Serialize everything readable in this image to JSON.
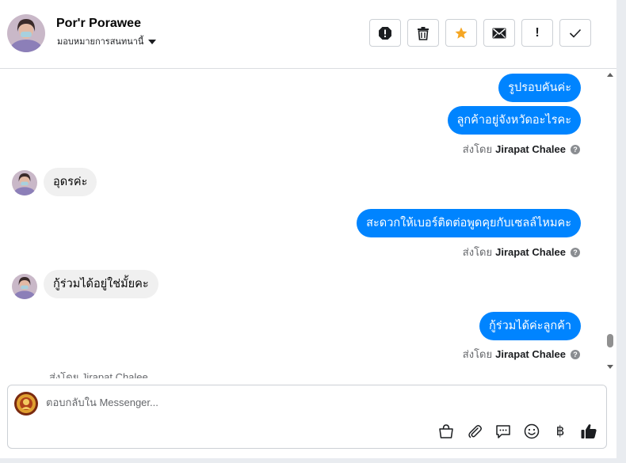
{
  "header": {
    "name": "Por'r Porawee",
    "assign_label": "มอบหมายการสนทนานี้"
  },
  "actions": [
    {
      "icon": "spam-icon"
    },
    {
      "icon": "trash-icon"
    },
    {
      "icon": "star-icon",
      "color": "#f5a623"
    },
    {
      "icon": "envelope-icon"
    },
    {
      "icon": "exclamation-icon",
      "label": "!"
    },
    {
      "icon": "check-icon"
    }
  ],
  "messages": {
    "out1": "รูปรอบคันค่ะ",
    "out2": "ลูกค้าอยู่จังหวัดอะไรคะ",
    "sent_by_label": "ส่งโดย",
    "sender_name": "Jirapat Chalee",
    "in1": "อุดรค่ะ",
    "out3": "สะดวกให้เบอร์ติดต่อพูดคุยกับเซลล์ไหมคะ",
    "in2": "กู้ร่วมได้อยู่ใช่มั้ยคะ",
    "out4": "กู้ร่วมได้ค่ะลูกค้า",
    "partial": "ส่งโดย Jirapat Chalee"
  },
  "composer": {
    "placeholder": "ตอบกลับใน Messenger..."
  },
  "tools": [
    {
      "icon": "basket-icon"
    },
    {
      "icon": "paperclip-icon"
    },
    {
      "icon": "saved-reply-icon"
    },
    {
      "icon": "emoji-icon"
    },
    {
      "icon": "baht-icon",
      "label": "฿"
    },
    {
      "icon": "thumbs-up-icon"
    }
  ],
  "colors": {
    "accent": "#0084ff",
    "incoming_bubble": "#f0f0f0",
    "star": "#f5a623"
  }
}
